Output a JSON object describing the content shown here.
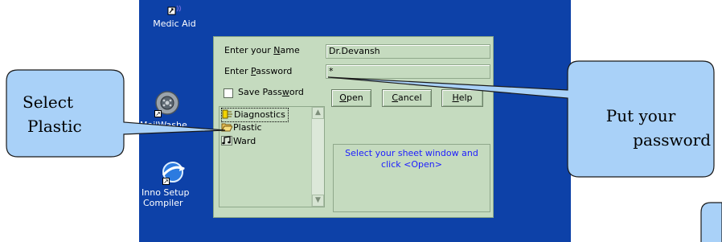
{
  "desktop": {
    "icons": [
      {
        "label": "Medic Aid"
      },
      {
        "label": "MailWashe"
      },
      {
        "label": "Inno Setup Compiler",
        "line1": "Inno Setup",
        "line2": "Compiler"
      }
    ]
  },
  "dialog": {
    "name_label_pre": "Enter your ",
    "name_label_key": "N",
    "name_label_post": "ame",
    "name_value": "Dr.Devansh",
    "password_label_pre": "Enter ",
    "password_label_key": "P",
    "password_label_post": "assword",
    "password_value": "*",
    "save_password_pre": "Save Pass",
    "save_password_key": "w",
    "save_password_post": "ord",
    "open_button_key": "O",
    "open_button_rest": "pen",
    "cancel_button_key": "C",
    "cancel_button_rest": "ancel",
    "help_button_key": "H",
    "help_button_rest": "elp",
    "list_items": [
      {
        "label": "Diagnostics",
        "icon": "diagnostics-icon"
      },
      {
        "label": "Plastic",
        "icon": "open-folder-icon"
      },
      {
        "label": "Ward",
        "icon": "music-note-icon"
      }
    ],
    "info_text": "Select your sheet window and click <Open>"
  },
  "callouts": {
    "left_line1": "Select",
    "left_line2": "Plastic",
    "right_line1": "Put your",
    "right_line2": "password"
  },
  "colors": {
    "desktop": "#0d41a8",
    "dialog_bg": "#c5dbbf",
    "callout_fill": "#a9d1f8",
    "info_text": "#1c1cff"
  }
}
